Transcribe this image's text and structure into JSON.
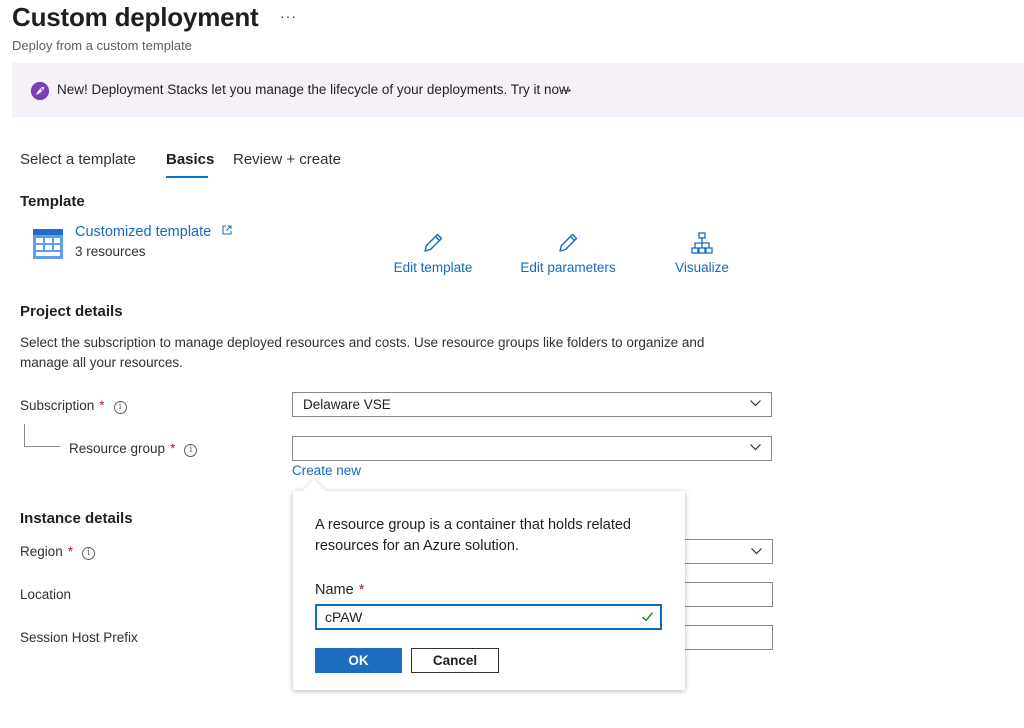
{
  "header": {
    "title": "Custom deployment",
    "more_label": "···",
    "subtitle": "Deploy from a custom template"
  },
  "banner": {
    "icon": "rocket-icon",
    "text": "New! Deployment Stacks let you manage the lifecycle of your deployments. Try it now",
    "arrow": "→",
    "background": "#f6f0f9"
  },
  "tabs": [
    {
      "label": "Select a template",
      "active": false
    },
    {
      "label": "Basics",
      "active": true
    },
    {
      "label": "Review + create",
      "active": false
    }
  ],
  "template": {
    "heading": "Template",
    "link_label": "Customized template",
    "resource_count": "3 resources",
    "actions": [
      {
        "label": "Edit template",
        "icon": "pencil-icon"
      },
      {
        "label": "Edit parameters",
        "icon": "pencil-icon"
      },
      {
        "label": "Visualize",
        "icon": "hierarchy-icon"
      }
    ]
  },
  "project": {
    "heading": "Project details",
    "description": "Select the subscription to manage deployed resources and costs. Use resource groups like folders to organize and manage all your resources.",
    "subscription_label": "Subscription",
    "subscription_value": "Delaware VSE",
    "resource_group_label": "Resource group",
    "resource_group_value": "",
    "create_new_label": "Create new",
    "required_mark": "*",
    "info_mark": "i"
  },
  "instance": {
    "heading": "Instance details",
    "region_label": "Region",
    "location_label": "Location",
    "session_host_label": "Session Host Prefix"
  },
  "popup": {
    "description": "A resource group is a container that holds related resources for an Azure solution.",
    "name_label": "Name",
    "name_value": "cPAW",
    "ok_label": "OK",
    "cancel_label": "Cancel"
  },
  "colors": {
    "accent": "#0f6cbd",
    "primary_button": "#1c6cc0",
    "required": "#a4262c",
    "success": "#107c10",
    "banner_icon": "#7a3fb8"
  }
}
